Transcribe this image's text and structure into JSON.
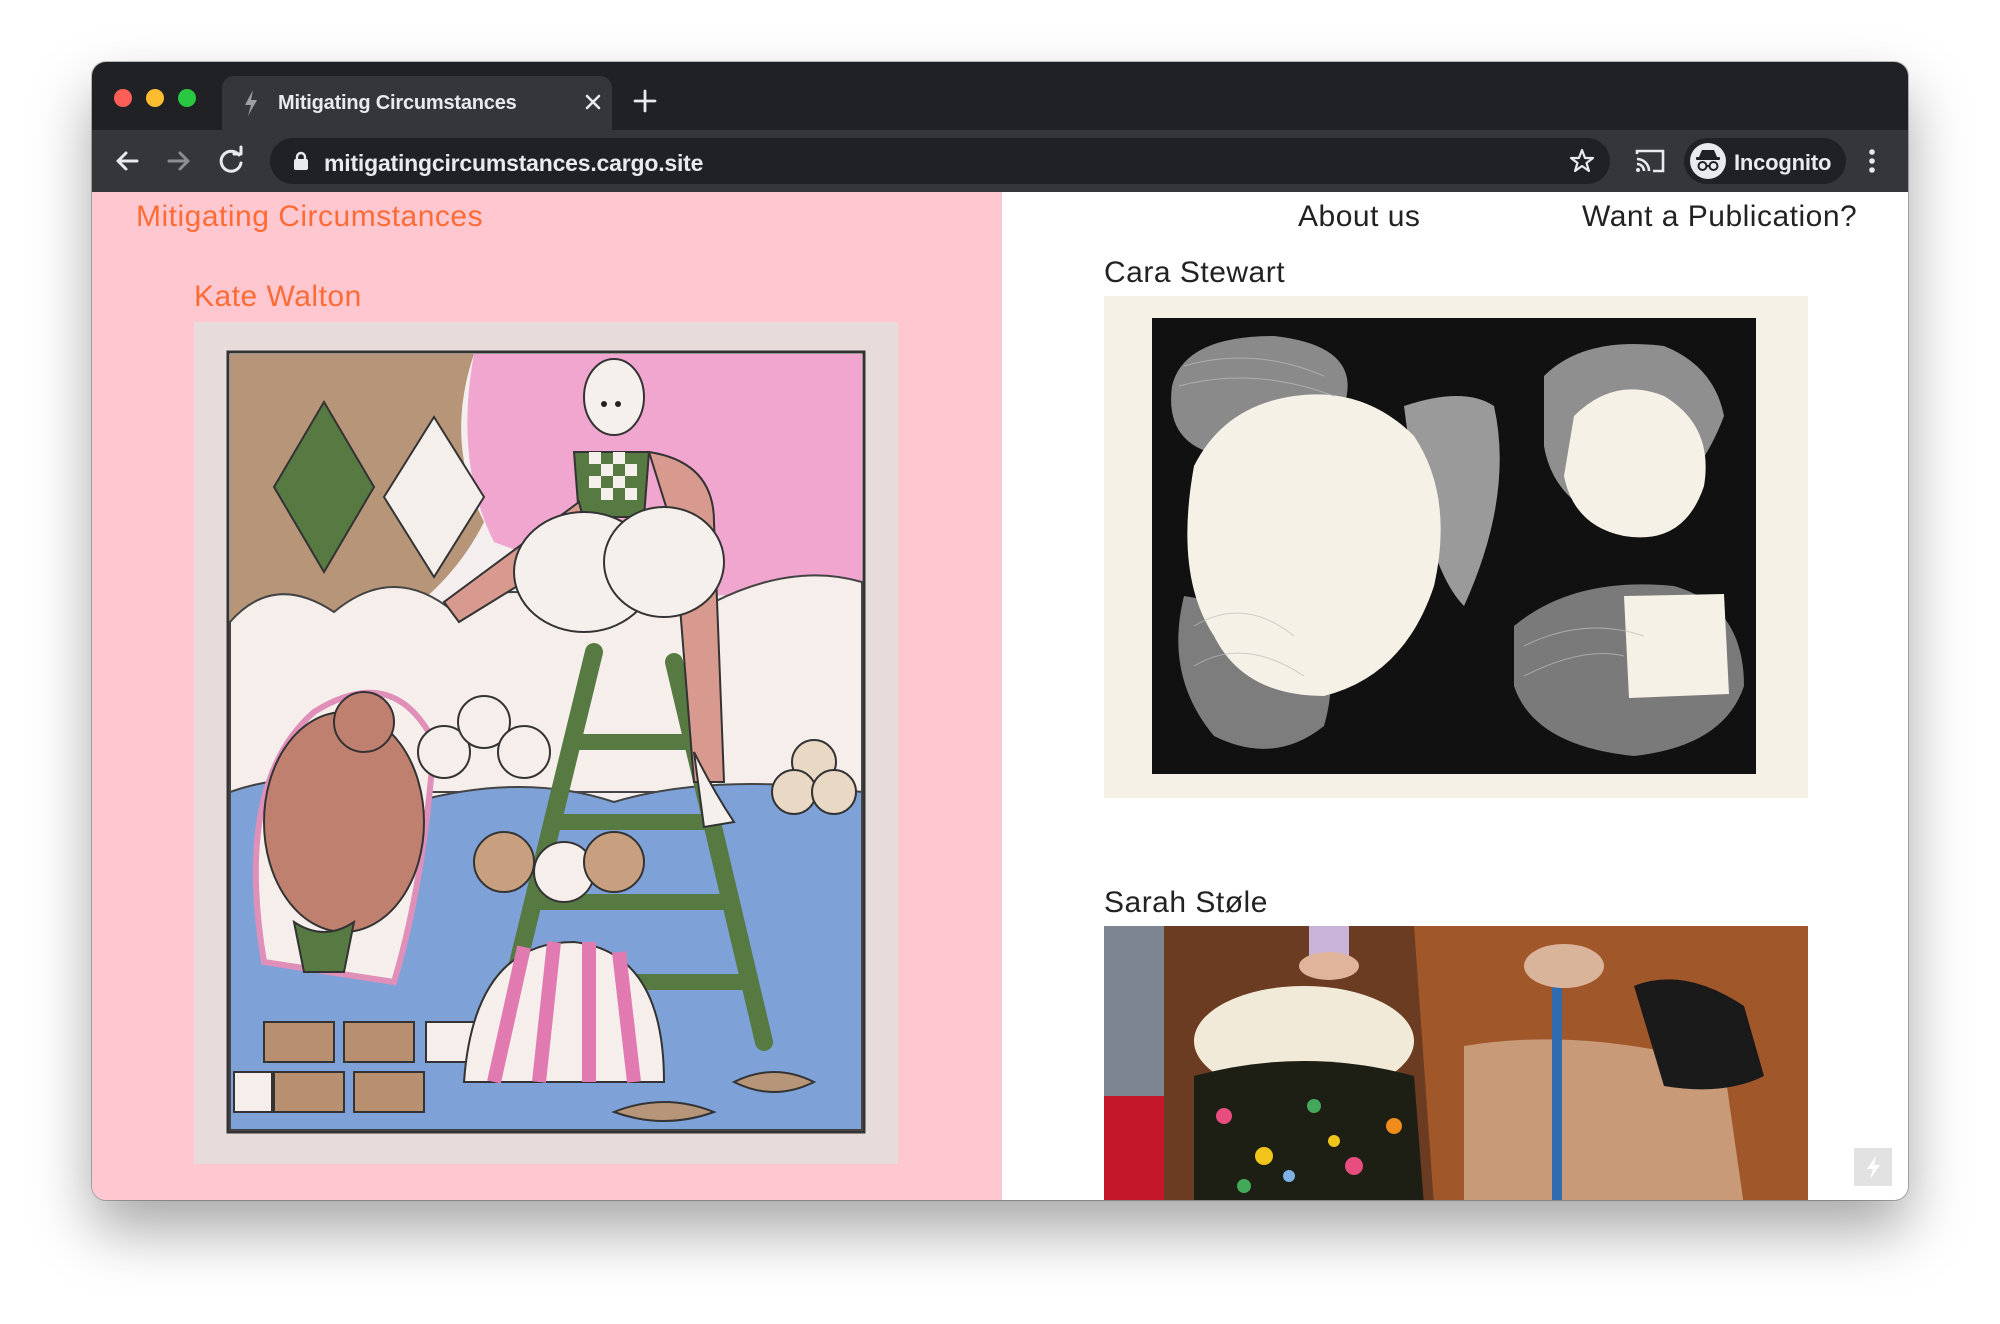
{
  "browser": {
    "tab_title": "Mitigating Circumstances",
    "url": "mitigatingcircumstances.cargo.site",
    "profile_label": "Incognito"
  },
  "site": {
    "title": "Mitigating Circumstances",
    "nav": {
      "about": "About us",
      "publication": "Want a Publication?"
    },
    "artists": [
      {
        "name": "Kate Walton"
      },
      {
        "name": "Cara Stewart"
      },
      {
        "name": "Sarah Støle"
      }
    ]
  },
  "colors": {
    "left_panel_bg": "#ffc8d1",
    "accent_orange": "#ff6b35",
    "chrome_dark": "#202124",
    "chrome_tab": "#35363a"
  },
  "icons": [
    "close-light",
    "minimize-light",
    "zoom-light",
    "bolt-icon",
    "close-icon",
    "plus-icon",
    "back-arrow-icon",
    "forward-arrow-icon",
    "reload-icon",
    "lock-icon",
    "star-icon",
    "cast-icon",
    "incognito-icon",
    "kebab-menu-icon",
    "cargo-bolt-icon"
  ]
}
